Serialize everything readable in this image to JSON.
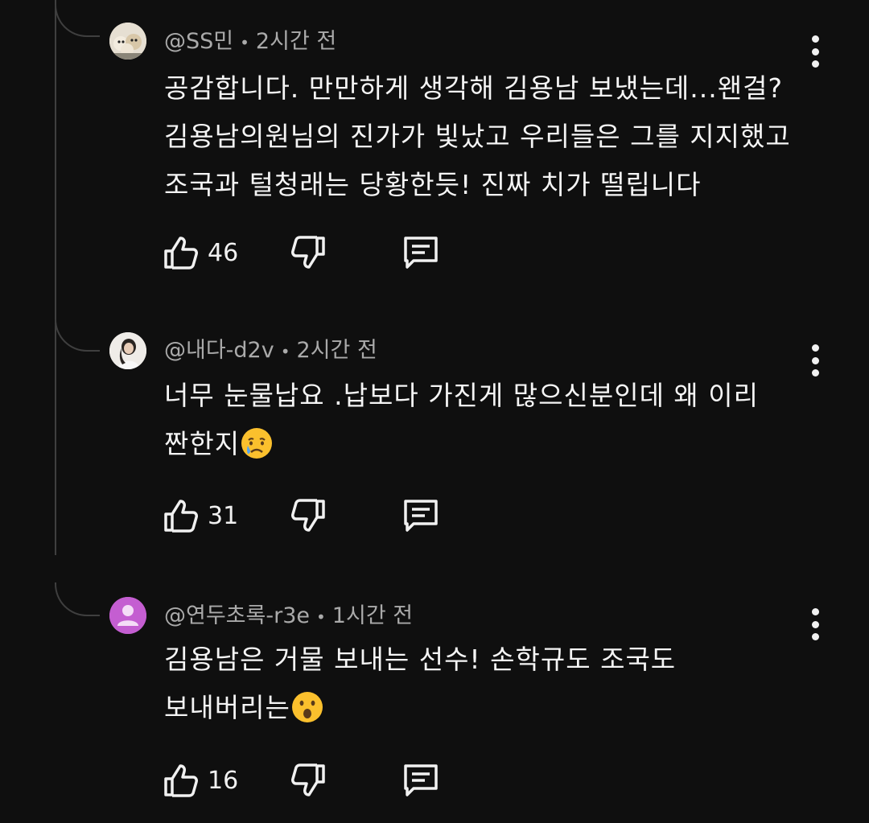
{
  "colors": {
    "background": "#0f0f0f",
    "thread_line": "#3f3f3f",
    "meta_text": "#aaaaaa",
    "body_text": "#f5f5f5",
    "avatar3_bg": "#c45ed1"
  },
  "comments": [
    {
      "author": "@SS민",
      "time": "2시간 전",
      "lines": [
        "공감합니다. 만만하게 생각해 김용남 보냈는데...왠걸?",
        "김용남의원님의 진가가 빛났고 우리들은 그를 지지했고",
        "조국과 털청래는 당황한듯! 진짜 치가 떨립니다"
      ],
      "likes": "46",
      "avatar_icon": "puppies-photo-avatar"
    },
    {
      "author": "@내다-d2v",
      "time": "2시간 전",
      "lines": [
        "너무 눈물납요 .납보다 가진게 많으신분인데 왜 이리",
        "짠한지"
      ],
      "emoji": "crying-face-emoji",
      "likes": "31",
      "avatar_icon": "person-photo-avatar"
    },
    {
      "author": "@연두초록-r3e",
      "time": "1시간 전",
      "lines": [
        "김용남은 거물 보내는 선수! 손학규도 조국도",
        "보내버리는"
      ],
      "emoji": "surprised-face-emoji",
      "likes": "16",
      "avatar_icon": "default-person-avatar"
    }
  ],
  "icons": {
    "like": "thumbs-up-icon",
    "dislike": "thumbs-down-icon",
    "reply": "reply-comment-icon",
    "more": "more-vertical-icon"
  }
}
